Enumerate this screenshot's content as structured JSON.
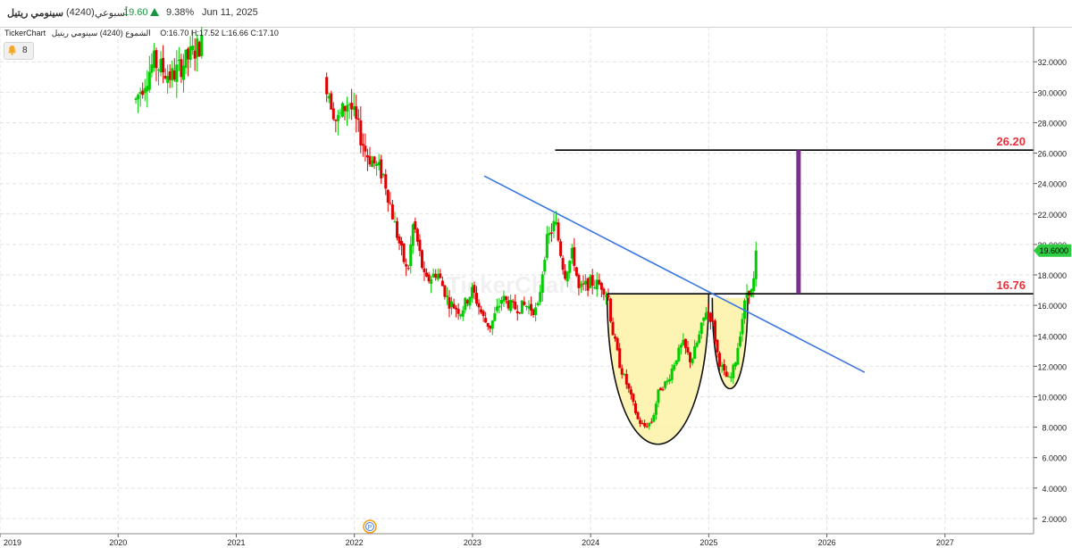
{
  "header": {
    "symbol_name": "سينومي ريتيل",
    "symbol_code": "(4240)",
    "period": "أسبوعي",
    "price": "19.60",
    "change_pct": "9.38%",
    "date": "Jun 11, 2025",
    "up_color": "#1a9641"
  },
  "info": {
    "source": "TickerChart",
    "series_label": "الشموع (4240) سينومي ريتيل",
    "ohlc": "O:16.70  H:17.52  L:16.66  C:17.10"
  },
  "alerts": {
    "count": "8",
    "icon": "bell-icon"
  },
  "watermark": "TickerChart",
  "chart_data": {
    "type": "candlestick",
    "interval": "weekly",
    "x_range": [
      2019.0,
      2027.75
    ],
    "ylim": [
      1.0,
      34.3
    ],
    "x_ticks": [
      "2019",
      "2020",
      "2021",
      "2022",
      "2023",
      "2024",
      "2025",
      "2026",
      "2027"
    ],
    "y_ticks": [
      "2.0000",
      "4.0000",
      "6.0000",
      "8.0000",
      "10.0000",
      "12.0000",
      "14.0000",
      "16.0000",
      "18.0000",
      "20.0000",
      "22.0000",
      "24.0000",
      "26.0000",
      "28.0000",
      "30.0000",
      "32.0000"
    ],
    "last_price": 19.6,
    "last_price_label": "19.6000",
    "grid": true,
    "colors": {
      "up": "#00cc00",
      "down": "#e00000",
      "trendline": "#3a77e0",
      "target": "#7b2e8e",
      "level_label": "#e8303a",
      "cup_fill": "#fdf1a6"
    },
    "key_path": [
      [
        2020.15,
        29.5
      ],
      [
        2020.3,
        32.0
      ],
      [
        2020.45,
        31.0
      ],
      [
        2020.7,
        33.2
      ],
      [
        2021.75,
        31.0
      ],
      [
        2021.85,
        28.0
      ],
      [
        2021.95,
        29.5
      ],
      [
        2022.1,
        26.0
      ],
      [
        2022.25,
        24.5
      ],
      [
        2022.35,
        21.0
      ],
      [
        2022.45,
        18.0
      ],
      [
        2022.5,
        21.5
      ],
      [
        2022.6,
        17.5
      ],
      [
        2022.7,
        18.2
      ],
      [
        2022.8,
        16.2
      ],
      [
        2022.9,
        15.6
      ],
      [
        2023.0,
        17.0
      ],
      [
        2023.1,
        15.0
      ],
      [
        2023.15,
        14.6
      ],
      [
        2023.25,
        16.5
      ],
      [
        2023.35,
        15.8
      ],
      [
        2023.45,
        16.0
      ],
      [
        2023.55,
        15.6
      ],
      [
        2023.62,
        20.0
      ],
      [
        2023.7,
        21.5
      ],
      [
        2023.78,
        18.0
      ],
      [
        2023.85,
        19.5
      ],
      [
        2023.9,
        17.0
      ],
      [
        2024.0,
        17.5
      ],
      [
        2024.1,
        17.3
      ],
      [
        2024.15,
        16.5
      ],
      [
        2024.18,
        14.5
      ],
      [
        2024.25,
        12.0
      ],
      [
        2024.32,
        10.5
      ],
      [
        2024.4,
        8.5
      ],
      [
        2024.45,
        8.0
      ],
      [
        2024.52,
        8.4
      ],
      [
        2024.58,
        10.5
      ],
      [
        2024.65,
        11.0
      ],
      [
        2024.72,
        12.5
      ],
      [
        2024.78,
        13.5
      ],
      [
        2024.85,
        12.3
      ],
      [
        2024.92,
        14.0
      ],
      [
        2024.98,
        15.8
      ],
      [
        2025.03,
        15.0
      ],
      [
        2025.08,
        12.5
      ],
      [
        2025.13,
        11.5
      ],
      [
        2025.18,
        11.0
      ],
      [
        2025.23,
        12.5
      ],
      [
        2025.28,
        15.0
      ],
      [
        2025.33,
        17.2
      ],
      [
        2025.36,
        16.8
      ],
      [
        2025.38,
        17.5
      ],
      [
        2025.41,
        19.6
      ]
    ],
    "annotations": [
      {
        "type": "hline",
        "y": 26.2,
        "x_start": 2023.7,
        "x_end": 2027.75,
        "label": "26.20"
      },
      {
        "type": "hline",
        "y": 16.76,
        "x_start": 2024.14,
        "x_end": 2027.75,
        "label": "16.76"
      },
      {
        "type": "trendline",
        "points": [
          [
            2023.1,
            24.5
          ],
          [
            2026.32,
            11.6
          ]
        ]
      },
      {
        "type": "target_bar",
        "x": 2025.76,
        "y1": 16.76,
        "y2": 26.2
      },
      {
        "type": "cup",
        "x1": 2024.14,
        "x2": 2025.0,
        "top": 16.76,
        "bottom": 7.0
      },
      {
        "type": "handle",
        "x1": 2025.03,
        "x2": 2025.33,
        "top": 16.5,
        "bottom": 10.6
      }
    ]
  }
}
